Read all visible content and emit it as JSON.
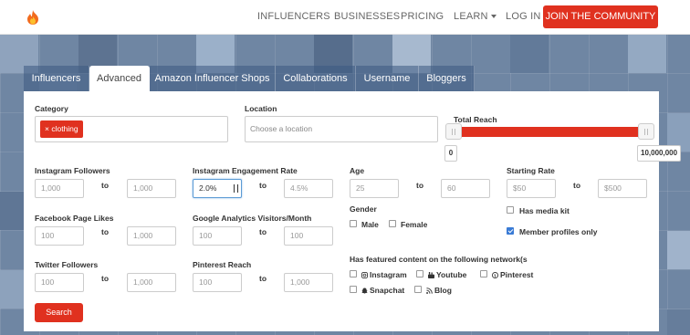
{
  "nav": {
    "links": [
      "INFLUENCERS",
      "BUSINESSES",
      "PRICING",
      "LEARN",
      "LOG IN"
    ],
    "join": "JOIN THE COMMUNITY"
  },
  "tabs": [
    "Influencers",
    "Advanced",
    "Amazon Influencer Shops",
    "Collaborations",
    "Username",
    "Bloggers"
  ],
  "active_tab": "Advanced",
  "category": {
    "label": "Category",
    "tag": "× clothing"
  },
  "location": {
    "label": "Location",
    "placeholder": "Choose a location"
  },
  "total_reach": {
    "label": "Total Reach",
    "min": "0",
    "max": "10,000,000",
    "range": [
      0,
      10000000
    ]
  },
  "to": "to",
  "instagram_followers": {
    "label": "Instagram Followers",
    "from": "1,000",
    "to_val": "1,000"
  },
  "instagram_engagement": {
    "label": "Instagram Engagement Rate",
    "from": "2.0%",
    "to_val": "4.5%"
  },
  "age": {
    "label": "Age",
    "from": "25",
    "to_val": "60"
  },
  "starting_rate": {
    "label": "Starting Rate",
    "from": "$50",
    "to_val": "$500"
  },
  "facebook_likes": {
    "label": "Facebook Page Likes",
    "from": "100",
    "to_val": "1,000"
  },
  "google_analytics": {
    "label": "Google Analytics Visitors/Month",
    "from": "100",
    "to_val": "100"
  },
  "gender": {
    "label": "Gender",
    "male": "Male",
    "female": "Female"
  },
  "media_kit": {
    "label": "Has media kit",
    "checked": false
  },
  "member_profiles": {
    "label": "Member profiles only",
    "checked": true
  },
  "twitter_followers": {
    "label": "Twitter Followers",
    "from": "100",
    "to_val": "1,000"
  },
  "pinterest_reach": {
    "label": "Pinterest Reach",
    "from": "100",
    "to_val": "1,000"
  },
  "networks": {
    "label": "Has featured content on the following network(s",
    "items": [
      "Instagram",
      "Youtube",
      "Pinterest",
      "Snapchat",
      "Blog"
    ]
  },
  "search_button": "Search",
  "colors": {
    "brand_red": "#e0311f",
    "check_blue": "#3a7bd5"
  }
}
